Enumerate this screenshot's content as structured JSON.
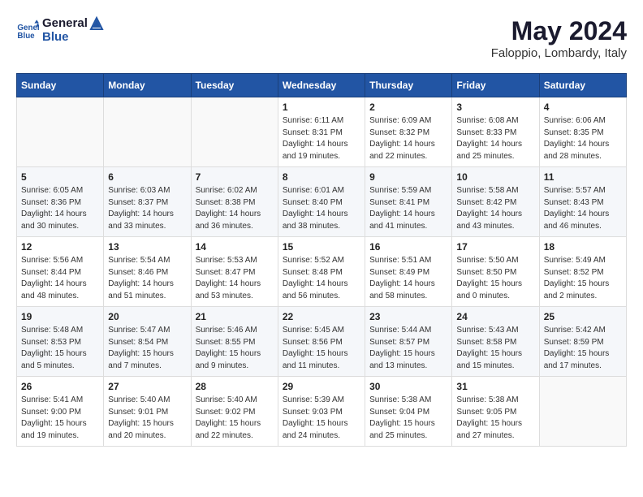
{
  "logo": {
    "line1": "General",
    "line2": "Blue"
  },
  "title": "May 2024",
  "subtitle": "Faloppio, Lombardy, Italy",
  "headers": [
    "Sunday",
    "Monday",
    "Tuesday",
    "Wednesday",
    "Thursday",
    "Friday",
    "Saturday"
  ],
  "weeks": [
    [
      {
        "day": "",
        "info": ""
      },
      {
        "day": "",
        "info": ""
      },
      {
        "day": "",
        "info": ""
      },
      {
        "day": "1",
        "info": "Sunrise: 6:11 AM\nSunset: 8:31 PM\nDaylight: 14 hours\nand 19 minutes."
      },
      {
        "day": "2",
        "info": "Sunrise: 6:09 AM\nSunset: 8:32 PM\nDaylight: 14 hours\nand 22 minutes."
      },
      {
        "day": "3",
        "info": "Sunrise: 6:08 AM\nSunset: 8:33 PM\nDaylight: 14 hours\nand 25 minutes."
      },
      {
        "day": "4",
        "info": "Sunrise: 6:06 AM\nSunset: 8:35 PM\nDaylight: 14 hours\nand 28 minutes."
      }
    ],
    [
      {
        "day": "5",
        "info": "Sunrise: 6:05 AM\nSunset: 8:36 PM\nDaylight: 14 hours\nand 30 minutes."
      },
      {
        "day": "6",
        "info": "Sunrise: 6:03 AM\nSunset: 8:37 PM\nDaylight: 14 hours\nand 33 minutes."
      },
      {
        "day": "7",
        "info": "Sunrise: 6:02 AM\nSunset: 8:38 PM\nDaylight: 14 hours\nand 36 minutes."
      },
      {
        "day": "8",
        "info": "Sunrise: 6:01 AM\nSunset: 8:40 PM\nDaylight: 14 hours\nand 38 minutes."
      },
      {
        "day": "9",
        "info": "Sunrise: 5:59 AM\nSunset: 8:41 PM\nDaylight: 14 hours\nand 41 minutes."
      },
      {
        "day": "10",
        "info": "Sunrise: 5:58 AM\nSunset: 8:42 PM\nDaylight: 14 hours\nand 43 minutes."
      },
      {
        "day": "11",
        "info": "Sunrise: 5:57 AM\nSunset: 8:43 PM\nDaylight: 14 hours\nand 46 minutes."
      }
    ],
    [
      {
        "day": "12",
        "info": "Sunrise: 5:56 AM\nSunset: 8:44 PM\nDaylight: 14 hours\nand 48 minutes."
      },
      {
        "day": "13",
        "info": "Sunrise: 5:54 AM\nSunset: 8:46 PM\nDaylight: 14 hours\nand 51 minutes."
      },
      {
        "day": "14",
        "info": "Sunrise: 5:53 AM\nSunset: 8:47 PM\nDaylight: 14 hours\nand 53 minutes."
      },
      {
        "day": "15",
        "info": "Sunrise: 5:52 AM\nSunset: 8:48 PM\nDaylight: 14 hours\nand 56 minutes."
      },
      {
        "day": "16",
        "info": "Sunrise: 5:51 AM\nSunset: 8:49 PM\nDaylight: 14 hours\nand 58 minutes."
      },
      {
        "day": "17",
        "info": "Sunrise: 5:50 AM\nSunset: 8:50 PM\nDaylight: 15 hours\nand 0 minutes."
      },
      {
        "day": "18",
        "info": "Sunrise: 5:49 AM\nSunset: 8:52 PM\nDaylight: 15 hours\nand 2 minutes."
      }
    ],
    [
      {
        "day": "19",
        "info": "Sunrise: 5:48 AM\nSunset: 8:53 PM\nDaylight: 15 hours\nand 5 minutes."
      },
      {
        "day": "20",
        "info": "Sunrise: 5:47 AM\nSunset: 8:54 PM\nDaylight: 15 hours\nand 7 minutes."
      },
      {
        "day": "21",
        "info": "Sunrise: 5:46 AM\nSunset: 8:55 PM\nDaylight: 15 hours\nand 9 minutes."
      },
      {
        "day": "22",
        "info": "Sunrise: 5:45 AM\nSunset: 8:56 PM\nDaylight: 15 hours\nand 11 minutes."
      },
      {
        "day": "23",
        "info": "Sunrise: 5:44 AM\nSunset: 8:57 PM\nDaylight: 15 hours\nand 13 minutes."
      },
      {
        "day": "24",
        "info": "Sunrise: 5:43 AM\nSunset: 8:58 PM\nDaylight: 15 hours\nand 15 minutes."
      },
      {
        "day": "25",
        "info": "Sunrise: 5:42 AM\nSunset: 8:59 PM\nDaylight: 15 hours\nand 17 minutes."
      }
    ],
    [
      {
        "day": "26",
        "info": "Sunrise: 5:41 AM\nSunset: 9:00 PM\nDaylight: 15 hours\nand 19 minutes."
      },
      {
        "day": "27",
        "info": "Sunrise: 5:40 AM\nSunset: 9:01 PM\nDaylight: 15 hours\nand 20 minutes."
      },
      {
        "day": "28",
        "info": "Sunrise: 5:40 AM\nSunset: 9:02 PM\nDaylight: 15 hours\nand 22 minutes."
      },
      {
        "day": "29",
        "info": "Sunrise: 5:39 AM\nSunset: 9:03 PM\nDaylight: 15 hours\nand 24 minutes."
      },
      {
        "day": "30",
        "info": "Sunrise: 5:38 AM\nSunset: 9:04 PM\nDaylight: 15 hours\nand 25 minutes."
      },
      {
        "day": "31",
        "info": "Sunrise: 5:38 AM\nSunset: 9:05 PM\nDaylight: 15 hours\nand 27 minutes."
      },
      {
        "day": "",
        "info": ""
      }
    ]
  ]
}
